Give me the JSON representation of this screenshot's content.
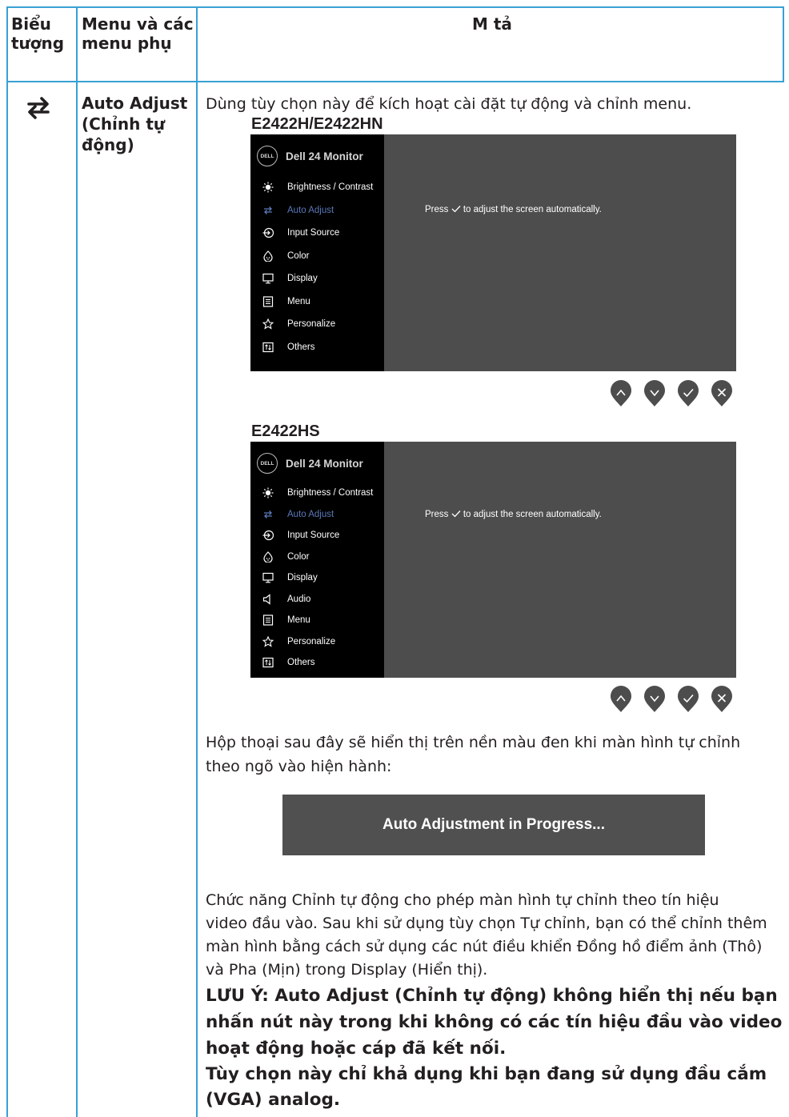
{
  "header": {
    "col1": "Biểu tượng",
    "col2": "Menu và các menu phụ",
    "col3": "M tả"
  },
  "row": {
    "icon_name": "auto-adjust-icon",
    "menu_name": "Auto Adjust (Chỉnh tự động)",
    "intro": "Dùng tùy chọn này để kích hoạt cài đặt tự động và chỉnh menu.",
    "osd1": {
      "model": "E2422H/E2422HN",
      "title": "Dell 24 Monitor",
      "logo": "DELL",
      "items": [
        {
          "label": "Brightness / Contrast",
          "icon": "brightness-icon"
        },
        {
          "label": "Auto Adjust",
          "icon": "auto-adjust-icon",
          "selected": true
        },
        {
          "label": "Input Source",
          "icon": "input-source-icon"
        },
        {
          "label": "Color",
          "icon": "color-icon"
        },
        {
          "label": "Display",
          "icon": "display-icon"
        },
        {
          "label": "Menu",
          "icon": "menu-icon"
        },
        {
          "label": "Personalize",
          "icon": "star-icon"
        },
        {
          "label": "Others",
          "icon": "others-icon"
        }
      ],
      "msg_pre": "Press",
      "msg_post": "to adjust the screen automatically."
    },
    "osd2": {
      "model": "E2422HS",
      "title": "Dell 24 Monitor",
      "logo": "DELL",
      "items": [
        {
          "label": "Brightness / Contrast",
          "icon": "brightness-icon"
        },
        {
          "label": "Auto Adjust",
          "icon": "auto-adjust-icon",
          "selected": true
        },
        {
          "label": "Input Source",
          "icon": "input-source-icon"
        },
        {
          "label": "Color",
          "icon": "color-icon"
        },
        {
          "label": "Display",
          "icon": "display-icon"
        },
        {
          "label": "Audio",
          "icon": "audio-icon"
        },
        {
          "label": "Menu",
          "icon": "menu-icon"
        },
        {
          "label": "Personalize",
          "icon": "star-icon"
        },
        {
          "label": "Others",
          "icon": "others-icon"
        }
      ],
      "msg_pre": "Press",
      "msg_post": "to adjust the screen automatically."
    },
    "buttons": [
      "up-button",
      "down-button",
      "check-button",
      "close-button"
    ],
    "dialog_intro_line1": "Hộp thoại sau đây sẽ hiển thị trên nền màu đen khi màn hình tự chỉnh",
    "dialog_intro_line2": "theo ngõ vào hiện hành:",
    "progress_text": "Auto Adjustment in Progress...",
    "desc_line1": "Chức năng Chỉnh tự động cho phép màn hình tự chỉnh theo tín hiệu",
    "desc_line2": "video đầu vào. Sau khi sử dụng tùy chọn Tự chỉnh, bạn có thể chỉnh thêm",
    "desc_line3": "màn hình bằng cách sử dụng các nút điều khiển Đồng hồ điểm ảnh (Thô)",
    "desc_line4": "và Pha (Mịn) trong Display (Hiển thị).",
    "note_line1": "LƯU Ý: Auto Adjust (Chỉnh tự động) không hiển thị nếu bạn",
    "note_line2": "nhấn nút này trong khi không có các tín hiệu đầu vào video",
    "note_line3": "hoạt động hoặc cáp đã kết nối.",
    "note2_line1": "Tùy chọn này chỉ khả dụng khi bạn đang sử dụng đầu cắm",
    "note2_line2": "(VGA) analog."
  },
  "colors": {
    "table_border": "#39a0d4",
    "osd_panel": "#4d4d4d",
    "osd_sidebar": "#000000",
    "button": "#4d4d4d"
  }
}
